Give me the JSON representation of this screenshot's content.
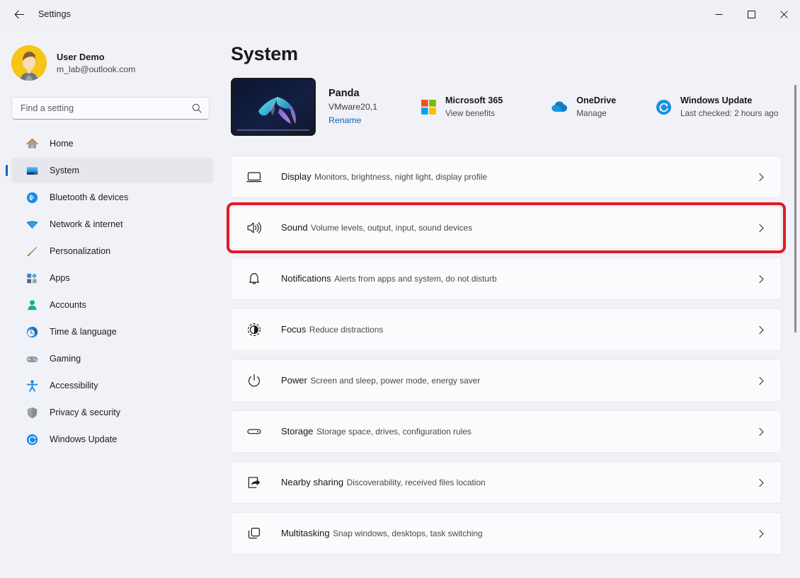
{
  "window": {
    "title": "Settings",
    "back_label": "Back",
    "minimize_label": "Minimize",
    "maximize_label": "Maximize",
    "close_label": "Close"
  },
  "account": {
    "name": "User Demo",
    "email": "m_lab@outlook.com",
    "avatar_icon": "user-avatar"
  },
  "search": {
    "placeholder": "Find a setting",
    "value": "",
    "icon": "search-icon"
  },
  "sidebar": {
    "items": [
      {
        "label": "Home",
        "icon": "home-icon",
        "active": false
      },
      {
        "label": "System",
        "icon": "system-icon",
        "active": true
      },
      {
        "label": "Bluetooth & devices",
        "icon": "bluetooth-icon",
        "active": false
      },
      {
        "label": "Network & internet",
        "icon": "network-icon",
        "active": false
      },
      {
        "label": "Personalization",
        "icon": "brush-icon",
        "active": false
      },
      {
        "label": "Apps",
        "icon": "apps-icon",
        "active": false
      },
      {
        "label": "Accounts",
        "icon": "accounts-icon",
        "active": false
      },
      {
        "label": "Time & language",
        "icon": "clock-icon",
        "active": false
      },
      {
        "label": "Gaming",
        "icon": "gamepad-icon",
        "active": false
      },
      {
        "label": "Accessibility",
        "icon": "accessibility-icon",
        "active": false
      },
      {
        "label": "Privacy & security",
        "icon": "shield-icon",
        "active": false
      },
      {
        "label": "Windows Update",
        "icon": "update-icon",
        "active": false
      }
    ]
  },
  "main": {
    "page_title": "System",
    "device": {
      "name": "Panda",
      "model": "VMware20,1",
      "rename_label": "Rename",
      "thumbnail_icon": "device-thumbnail"
    },
    "quick_links": [
      {
        "title": "Microsoft 365",
        "subtitle": "View benefits",
        "icon": "microsoft-365-icon"
      },
      {
        "title": "OneDrive",
        "subtitle": "Manage",
        "icon": "onedrive-icon"
      },
      {
        "title": "Windows Update",
        "subtitle": "Last checked: 2 hours ago",
        "icon": "windows-update-icon"
      }
    ],
    "settings": [
      {
        "title": "Display",
        "subtitle": "Monitors, brightness, night light, display profile",
        "icon": "display-icon",
        "highlighted": false
      },
      {
        "title": "Sound",
        "subtitle": "Volume levels, output, input, sound devices",
        "icon": "sound-icon",
        "highlighted": true
      },
      {
        "title": "Notifications",
        "subtitle": "Alerts from apps and system, do not disturb",
        "icon": "bell-icon",
        "highlighted": false
      },
      {
        "title": "Focus",
        "subtitle": "Reduce distractions",
        "icon": "focus-icon",
        "highlighted": false
      },
      {
        "title": "Power",
        "subtitle": "Screen and sleep, power mode, energy saver",
        "icon": "power-icon",
        "highlighted": false
      },
      {
        "title": "Storage",
        "subtitle": "Storage space, drives, configuration rules",
        "icon": "storage-icon",
        "highlighted": false
      },
      {
        "title": "Nearby sharing",
        "subtitle": "Discoverability, received files location",
        "icon": "nearby-sharing-icon",
        "highlighted": false
      },
      {
        "title": "Multitasking",
        "subtitle": "Snap windows, desktops, task switching",
        "icon": "multitasking-icon",
        "highlighted": false
      }
    ],
    "chevron_icon": "chevron-right-icon"
  },
  "colors": {
    "accent": "#0067c0",
    "highlight": "#e01b24",
    "link": "#0f5fb5",
    "sidebar_bg": "#f1f2f7",
    "card_bg": "#fbfbfd"
  }
}
